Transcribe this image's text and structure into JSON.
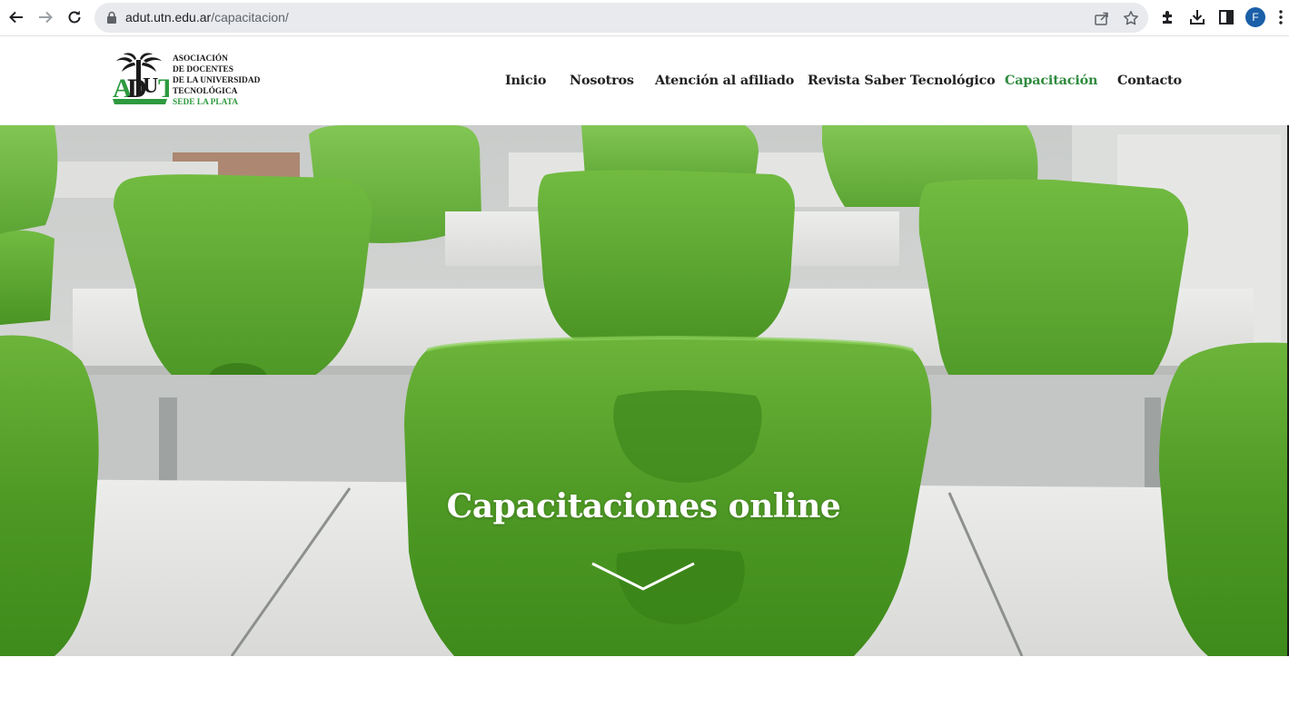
{
  "browser": {
    "url_domain": "adut.utn.edu.ar",
    "url_path": "/capacitacion/",
    "profile_initial": "F",
    "icons": [
      "back-icon",
      "forward-icon",
      "reload-icon",
      "lock-icon",
      "share-icon",
      "star-icon",
      "extensions-icon",
      "download-icon",
      "sidepanel-icon",
      "menu-icon"
    ]
  },
  "logo": {
    "mark": "ADUT",
    "lines": [
      "ASOCIACIÓN",
      "DE DOCENTES",
      "DE LA UNIVERSIDAD",
      "TECNOLÓGICA"
    ],
    "sede": "SEDE LA PLATA",
    "colors": {
      "green": "#2e9a3f",
      "dark": "#1b1b1b"
    }
  },
  "nav": {
    "items": [
      {
        "label": "Inicio",
        "active": false
      },
      {
        "label": "Nosotros",
        "active": false
      },
      {
        "label": "Atención al afiliado",
        "active": false
      },
      {
        "label": "Revista Saber Tecnológico",
        "active": false
      },
      {
        "label": "Capacitación",
        "active": true
      },
      {
        "label": "Contacto",
        "active": false
      }
    ],
    "colors": {
      "default": "#222222",
      "active": "#2e8b3e"
    }
  },
  "hero": {
    "title": "Capacitaciones online",
    "scroll_icon": "chevron-down-icon",
    "image_subject": "green-chairs-classroom"
  }
}
